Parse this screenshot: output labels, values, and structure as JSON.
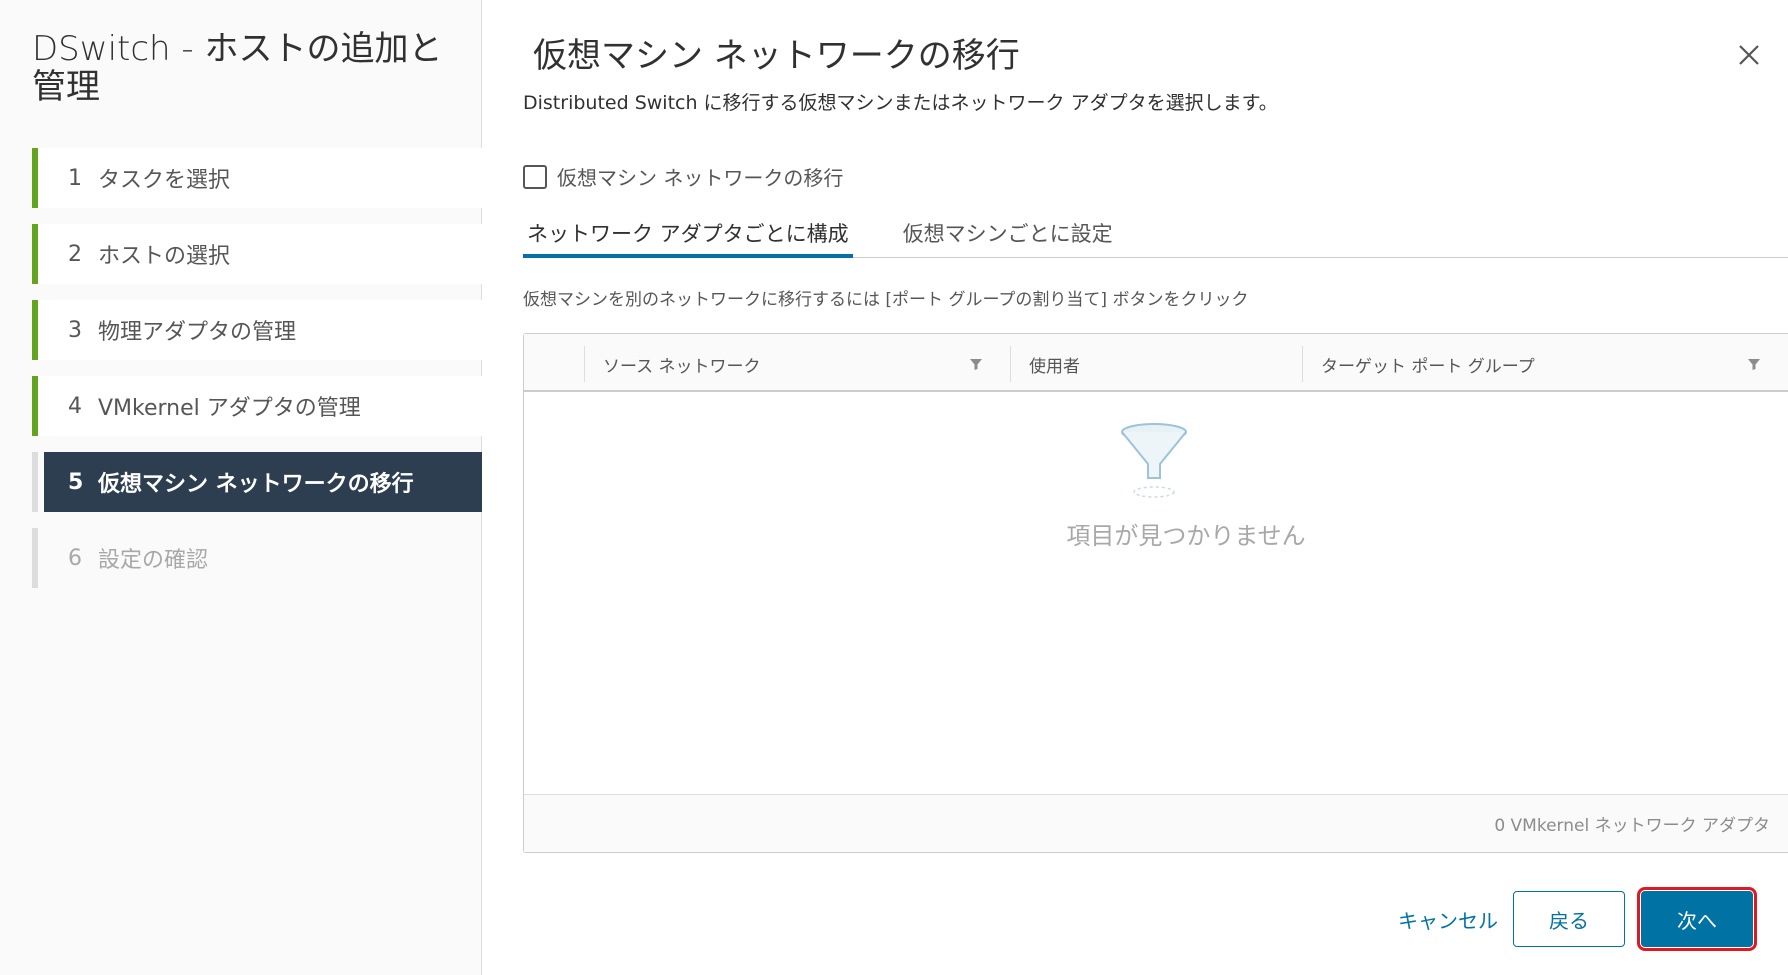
{
  "wizard": {
    "title": "DSwitch - ホストの追加と管理",
    "steps": [
      {
        "num": "1",
        "label": "タスクを選択",
        "state": "complete"
      },
      {
        "num": "2",
        "label": "ホストの選択",
        "state": "complete"
      },
      {
        "num": "3",
        "label": "物理アダプタの管理",
        "state": "complete"
      },
      {
        "num": "4",
        "label": "VMkernel アダプタの管理",
        "state": "complete"
      },
      {
        "num": "5",
        "label": "仮想マシン ネットワークの移行",
        "state": "active"
      },
      {
        "num": "6",
        "label": "設定の確認",
        "state": "disabled"
      }
    ]
  },
  "page": {
    "title": "仮想マシン ネットワークの移行",
    "subtitle": "Distributed Switch に移行する仮想マシンまたはネットワーク アダプタを選択します。",
    "checkbox_label": "仮想マシン ネットワークの移行",
    "checkbox_checked": false,
    "tabs": [
      {
        "label": "ネットワーク アダプタごとに構成",
        "active": true
      },
      {
        "label": "仮想マシンごとに設定",
        "active": false
      }
    ],
    "hint": "仮想マシンを別のネットワークに移行するには [ポート グループの割り当て] ボタンをクリック"
  },
  "grid": {
    "columns": [
      "ソース ネットワーク",
      "使用者",
      "ターゲット ポート グループ"
    ],
    "empty_text": "項目が見つかりません",
    "footer": "0 VMkernel ネットワーク アダプタ"
  },
  "footer": {
    "cancel": "キャンセル",
    "back": "戻る",
    "next": "次へ"
  },
  "colors": {
    "accent": "#0072a3",
    "complete": "#62a420",
    "active_step_bg": "#2c3e50",
    "highlight": "#e0181f"
  }
}
